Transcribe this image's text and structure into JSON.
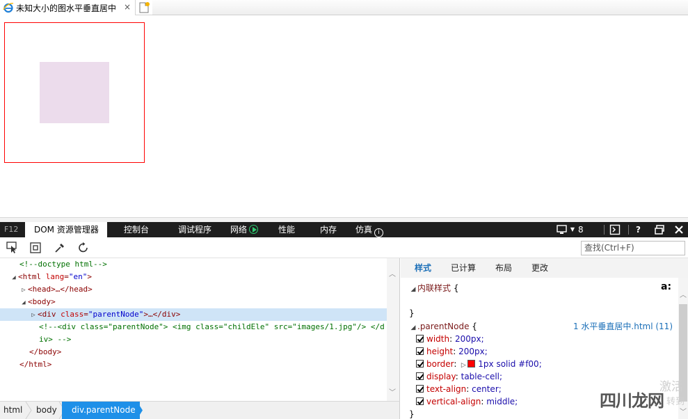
{
  "browser": {
    "tab_title": "未知大小的图水平垂直居中",
    "tab_close": "×"
  },
  "f12bar": {
    "f12_label": "F12",
    "tabs": [
      "DOM 资源管理器",
      "控制台",
      "调试程序",
      "网络",
      "性能",
      "内存",
      "仿真"
    ],
    "device_count": "8",
    "help": "?"
  },
  "toolbar": {
    "find_placeholder": "查找(Ctrl+F)"
  },
  "dom_tree": {
    "doctype": "<!--doctype html-->",
    "html_open_tag": "html",
    "lang_attr": "lang",
    "lang_value": "\"en\"",
    "head": "<head>…</head>",
    "body_open": "<body>",
    "div_tag": "div",
    "class_attr": "class",
    "class_value": "\"parentNode\"",
    "div_rest": ">…</div>",
    "comment_line1": "<!--<div class=\"parentNode\"> <img class=\"childEle\" src=\"images/1.jpg\"/> </d",
    "comment_line2": "iv> -->",
    "body_close": "</body>",
    "html_close": "</html>"
  },
  "breadcrumbs": [
    "html",
    "body",
    "div.parentNode"
  ],
  "styles": {
    "tabs": [
      "样式",
      "已计算",
      "布局",
      "更改"
    ],
    "inline_label": "内联样式",
    "open_brace": "{",
    "close_brace": "}",
    "aa": "a:",
    "rule_selector": ".parentNode",
    "rule_source": "1 水平垂直居中.html (11)",
    "properties": [
      {
        "name": "width",
        "value": "200px;"
      },
      {
        "name": "height",
        "value": "200px;"
      },
      {
        "name": "border",
        "value": "1px solid #f00;"
      },
      {
        "name": "display",
        "value": "table-cell;"
      },
      {
        "name": "text-align",
        "value": "center;"
      },
      {
        "name": "vertical-align",
        "value": "middle;"
      }
    ],
    "colon": ":"
  },
  "watermark": {
    "line1": "激活",
    "line2": "转到",
    "brand": "四川龙网"
  },
  "colors": {
    "parent_border": "#ff0000",
    "child_fill": "#ecdcec",
    "accent": "#1e90e8",
    "devbar": "#1e1e1e"
  }
}
